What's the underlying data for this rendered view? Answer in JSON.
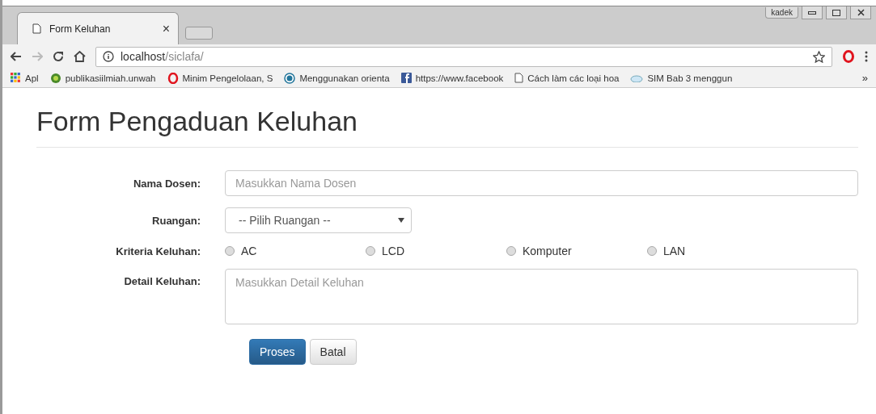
{
  "browser": {
    "tab": {
      "title": "Form Keluhan",
      "close": "×"
    },
    "profile": "kadek",
    "address": {
      "host": "localhost",
      "path": "/siclafa/"
    },
    "bookmarks": [
      {
        "kind": "apps",
        "label": "Apl"
      },
      {
        "kind": "globe",
        "label": "publikasiilmiah.unwah"
      },
      {
        "kind": "opera",
        "label": "Minim Pengelolaan, S"
      },
      {
        "kind": "wordpress",
        "label": "Menggunakan orienta"
      },
      {
        "kind": "facebook",
        "label": "https://www.facebook"
      },
      {
        "kind": "page",
        "label": "Cách làm các loại hoa"
      },
      {
        "kind": "cloud",
        "label": "SIM Bab 3 menggun"
      }
    ],
    "more": "»"
  },
  "page": {
    "title": "Form Pengaduan Keluhan",
    "fields": [
      {
        "kind": "text",
        "label": "Nama Dosen:",
        "placeholder": "Masukkan Nama Dosen"
      },
      {
        "kind": "select",
        "label": "Ruangan:",
        "value": "-- Pilih Ruangan --"
      },
      {
        "kind": "radio",
        "label": "Kriteria Keluhan:",
        "options": [
          {
            "label": "AC",
            "selected": false
          },
          {
            "label": "LCD",
            "selected": false
          },
          {
            "label": "Komputer",
            "selected": false
          },
          {
            "label": "LAN",
            "selected": false
          }
        ]
      },
      {
        "kind": "textarea",
        "label": "Detail Keluhan:",
        "placeholder": "Masukkan Detail Keluhan"
      }
    ],
    "buttons": [
      {
        "label": "Proses",
        "kind": "primary"
      },
      {
        "label": "Batal",
        "kind": "default"
      }
    ]
  }
}
